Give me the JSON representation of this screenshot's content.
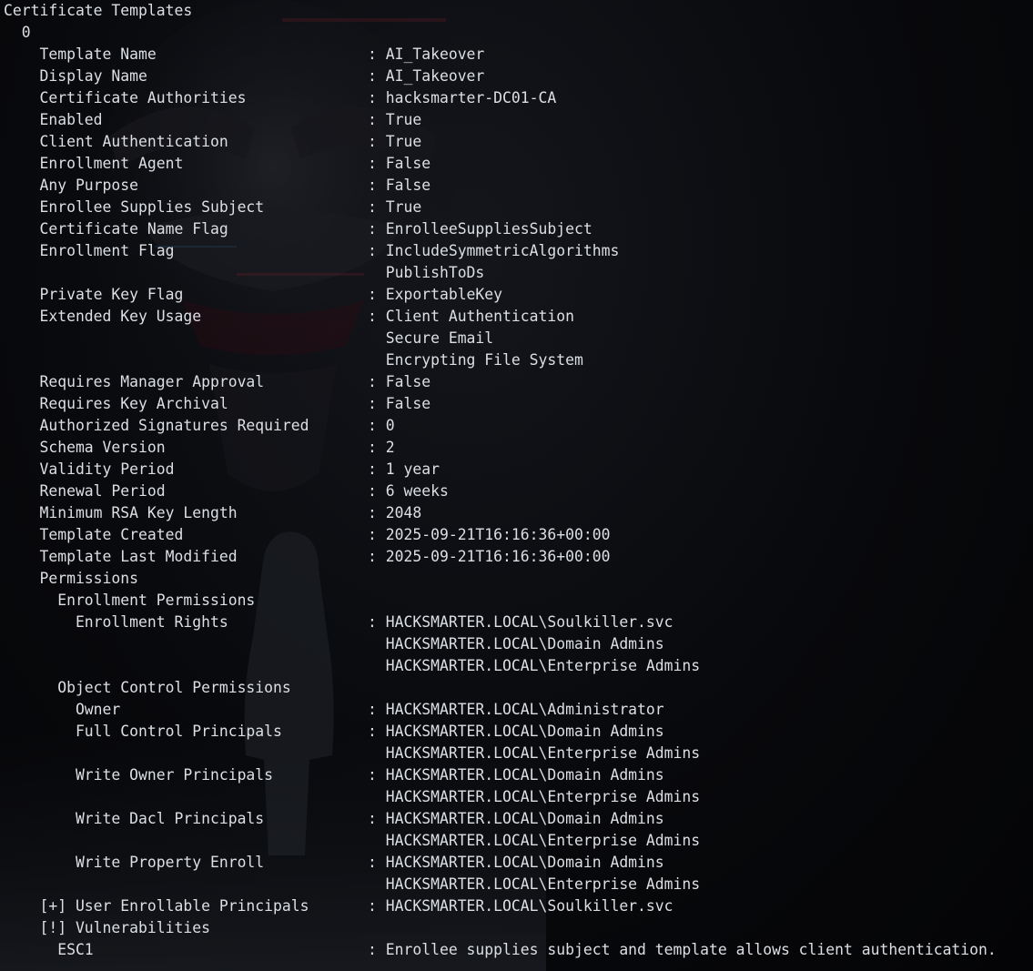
{
  "header": "Certificate Templates",
  "index": "0",
  "separator": ": ",
  "fields": [
    {
      "key": "Template Name",
      "values": [
        "AI_Takeover"
      ]
    },
    {
      "key": "Display Name",
      "values": [
        "AI_Takeover"
      ]
    },
    {
      "key": "Certificate Authorities",
      "values": [
        "hacksmarter-DC01-CA"
      ]
    },
    {
      "key": "Enabled",
      "values": [
        "True"
      ]
    },
    {
      "key": "Client Authentication",
      "values": [
        "True"
      ]
    },
    {
      "key": "Enrollment Agent",
      "values": [
        "False"
      ]
    },
    {
      "key": "Any Purpose",
      "values": [
        "False"
      ]
    },
    {
      "key": "Enrollee Supplies Subject",
      "values": [
        "True"
      ]
    },
    {
      "key": "Certificate Name Flag",
      "values": [
        "EnrolleeSuppliesSubject"
      ]
    },
    {
      "key": "Enrollment Flag",
      "values": [
        "IncludeSymmetricAlgorithms",
        "PublishToDs"
      ]
    },
    {
      "key": "Private Key Flag",
      "values": [
        "ExportableKey"
      ]
    },
    {
      "key": "Extended Key Usage",
      "values": [
        "Client Authentication",
        "Secure Email",
        "Encrypting File System"
      ]
    },
    {
      "key": "Requires Manager Approval",
      "values": [
        "False"
      ]
    },
    {
      "key": "Requires Key Archival",
      "values": [
        "False"
      ]
    },
    {
      "key": "Authorized Signatures Required",
      "values": [
        "0"
      ]
    },
    {
      "key": "Schema Version",
      "values": [
        "2"
      ]
    },
    {
      "key": "Validity Period",
      "values": [
        "1 year"
      ]
    },
    {
      "key": "Renewal Period",
      "values": [
        "6 weeks"
      ]
    },
    {
      "key": "Minimum RSA Key Length",
      "values": [
        "2048"
      ]
    },
    {
      "key": "Template Created",
      "values": [
        "2025-09-21T16:16:36+00:00"
      ]
    },
    {
      "key": "Template Last Modified",
      "values": [
        "2025-09-21T16:16:36+00:00"
      ]
    }
  ],
  "permissions": {
    "title": "Permissions",
    "enrollment": {
      "title": "Enrollment Permissions",
      "items": [
        {
          "key": "Enrollment Rights",
          "values": [
            "HACKSMARTER.LOCAL\\Soulkiller.svc",
            "HACKSMARTER.LOCAL\\Domain Admins",
            "HACKSMARTER.LOCAL\\Enterprise Admins"
          ]
        }
      ]
    },
    "object_control": {
      "title": "Object Control Permissions",
      "items": [
        {
          "key": "Owner",
          "values": [
            "HACKSMARTER.LOCAL\\Administrator"
          ]
        },
        {
          "key": "Full Control Principals",
          "values": [
            "HACKSMARTER.LOCAL\\Domain Admins",
            "HACKSMARTER.LOCAL\\Enterprise Admins"
          ]
        },
        {
          "key": "Write Owner Principals",
          "values": [
            "HACKSMARTER.LOCAL\\Domain Admins",
            "HACKSMARTER.LOCAL\\Enterprise Admins"
          ]
        },
        {
          "key": "Write Dacl Principals",
          "values": [
            "HACKSMARTER.LOCAL\\Domain Admins",
            "HACKSMARTER.LOCAL\\Enterprise Admins"
          ]
        },
        {
          "key": "Write Property Enroll",
          "values": [
            "HACKSMARTER.LOCAL\\Domain Admins",
            "HACKSMARTER.LOCAL\\Enterprise Admins"
          ]
        }
      ]
    }
  },
  "user_enrollable": {
    "key": "[+] User Enrollable Principals",
    "values": [
      "HACKSMARTER.LOCAL\\Soulkiller.svc"
    ]
  },
  "vulnerabilities": {
    "title": "[!] Vulnerabilities",
    "items": [
      {
        "key": "ESC1",
        "values": [
          "Enrollee supplies subject and template allows client authentication."
        ]
      }
    ]
  },
  "colors": {
    "text": "#dcdfe4",
    "background": "#030305"
  }
}
